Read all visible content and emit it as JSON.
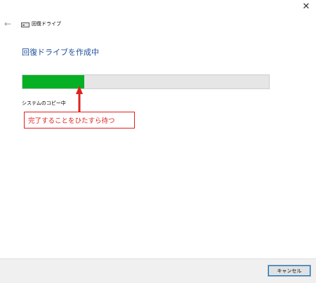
{
  "window": {
    "title": "回復ドライブ",
    "close_glyph": "✕",
    "back_glyph": "←",
    "icons": {
      "back": "back-arrow-icon",
      "drive": "drive-icon",
      "close": "close-icon"
    }
  },
  "main": {
    "heading": "回復ドライブを作成中",
    "progress": {
      "value": 0.25,
      "color": "#06b025",
      "track_color": "#e6e6e6"
    },
    "status": "システムのコピー中"
  },
  "annotation": {
    "text": "完了することをひたすら待つ",
    "color": "#e02020"
  },
  "footer": {
    "cancel_label": "キャンセル"
  },
  "colors": {
    "heading": "#1f4e9c",
    "footer_bg": "#f0f0f0",
    "focus_border": "#0078d7"
  }
}
